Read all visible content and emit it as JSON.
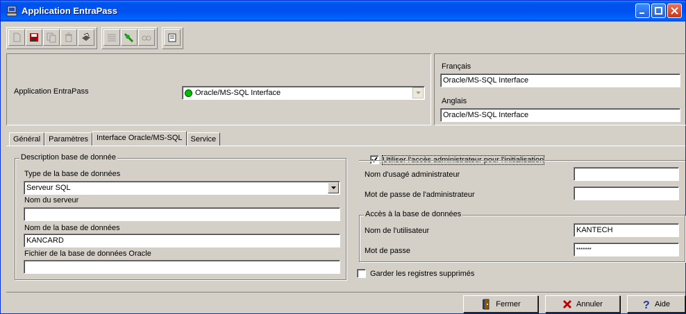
{
  "window": {
    "title": "Application EntraPass"
  },
  "toolbar": {
    "icons": [
      "new-icon",
      "save-icon",
      "copy-icon",
      "delete-icon",
      "print-icon",
      "list-icon",
      "link-icon",
      "find-icon",
      "info-icon"
    ]
  },
  "header": {
    "app_label": "Application EntraPass",
    "app_value": "Oracle/MS-SQL Interface",
    "status_color": "#00c000"
  },
  "lang": {
    "fr_label": "Français",
    "fr_value": "Oracle/MS-SQL Interface",
    "en_label": "Anglais",
    "en_value": "Oracle/MS-SQL Interface"
  },
  "tabs": [
    {
      "label": "Général"
    },
    {
      "label": "Paramètres"
    },
    {
      "label": "Interface Oracle/MS-SQL",
      "active": true
    },
    {
      "label": "Service"
    }
  ],
  "db_desc": {
    "legend": "Description base de donnée",
    "type_label": "Type de la base de données",
    "type_value": "Serveur SQL",
    "server_label": "Nom du serveur",
    "server_value": "",
    "dbname_label": "Nom de la base de données",
    "dbname_value": "KANCARD",
    "oracle_label": "Fichier de la base de données Oracle",
    "oracle_value": ""
  },
  "admin": {
    "checkbox_label": "Utiliser l'accès administrateur pour l'initialisation",
    "checked": true,
    "user_label": "Nom d'usagé administrateur",
    "user_value": "",
    "pass_label": "Mot de passe de l'administrateur",
    "pass_value": ""
  },
  "access": {
    "legend": "Accès à la base de données",
    "user_label": "Nom de l'utilisateur",
    "user_value": "KANTECH",
    "pass_label": "Mot de passe",
    "pass_value": "*******"
  },
  "keep_deleted": {
    "label": "Garder les registres supprimés",
    "checked": false
  },
  "buttons": {
    "close": "Fermer",
    "cancel": "Annuler",
    "help": "Aide"
  }
}
